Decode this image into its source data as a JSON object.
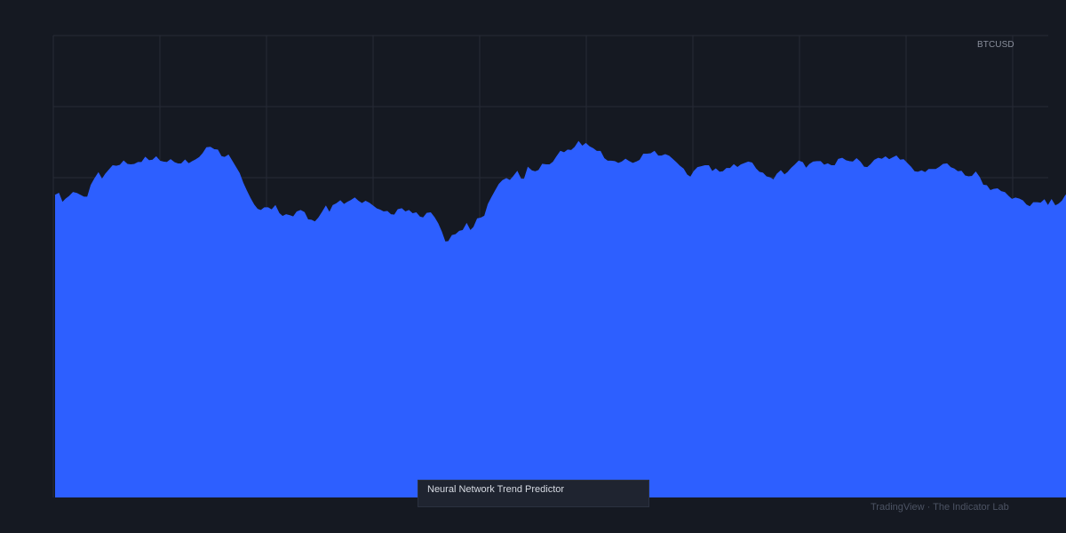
{
  "symbol": "BTCUSD",
  "indicator_label": "Neural Network Trend Predictor",
  "footer_brand": "TradingView · The Indicator Lab",
  "colors": {
    "background": "#151922",
    "grid": "#262b36",
    "area_fill": "#2d5fff"
  },
  "chart_data": {
    "type": "area",
    "title": "",
    "xlabel": "",
    "ylabel": "",
    "grid": true,
    "ylim": [
      0,
      100
    ],
    "x": [
      0,
      1,
      2,
      3,
      4,
      5,
      6,
      7,
      8,
      9,
      10,
      11,
      12,
      13,
      14,
      15,
      16,
      17,
      18,
      19,
      20,
      21,
      22,
      23,
      24,
      25,
      26,
      27,
      28,
      29,
      30,
      31,
      32,
      33,
      34,
      35,
      36,
      37,
      38,
      39,
      40,
      41,
      42,
      43,
      44,
      45,
      46,
      47,
      48,
      49,
      50,
      51,
      52,
      53,
      54,
      55,
      56,
      57,
      58,
      59,
      60,
      61,
      62,
      63,
      64,
      65,
      66,
      67,
      68,
      69,
      70,
      71,
      72,
      73,
      74,
      75,
      76,
      77,
      78,
      79,
      80,
      81,
      82,
      83,
      84,
      85,
      86,
      87,
      88,
      89,
      90,
      91,
      92,
      93,
      94,
      95,
      96,
      97,
      98,
      99,
      100,
      101,
      102,
      103,
      104,
      105,
      106,
      107,
      108,
      109,
      110,
      111,
      112,
      113,
      114,
      115,
      116,
      117,
      118,
      119,
      120,
      121,
      122,
      123,
      124,
      125,
      126,
      127,
      128,
      129,
      130,
      131,
      132,
      133,
      134,
      135,
      136,
      137,
      138,
      139,
      140,
      141,
      142,
      143,
      144,
      145,
      146,
      147,
      148,
      149,
      150,
      151,
      152,
      153,
      154,
      155,
      156,
      157,
      158,
      159,
      160,
      161,
      162,
      163,
      164,
      165,
      166,
      167,
      168,
      169,
      170,
      171,
      172,
      173,
      174,
      175,
      176,
      177,
      178,
      179,
      180,
      181,
      182,
      183,
      184,
      185,
      186,
      187,
      188,
      189,
      190,
      191,
      192,
      193,
      194,
      195,
      196,
      197,
      198,
      199,
      200,
      201,
      202,
      203,
      204,
      205,
      206,
      207,
      208,
      209,
      210,
      211,
      212,
      213,
      214,
      215,
      216,
      217,
      218,
      219,
      220,
      221,
      222,
      223,
      224,
      225,
      226,
      227,
      228,
      229,
      230,
      231,
      232,
      233,
      234,
      235,
      236,
      237,
      238,
      239,
      240,
      241,
      242,
      243,
      244,
      245,
      246,
      247,
      248,
      249,
      250,
      251,
      252,
      253,
      254,
      255,
      256,
      257,
      258,
      259,
      260,
      261,
      262,
      263,
      264,
      265,
      266,
      267,
      268,
      269,
      270,
      271,
      272,
      273,
      274,
      275,
      276,
      277,
      278,
      279,
      280,
      281,
      282,
      283,
      284
    ],
    "series": [
      {
        "values": [
          65.4,
          65.8,
          63.8,
          64.6,
          65.2,
          66.0,
          65.8,
          65.4,
          65.0,
          65.0,
          67.6,
          69.0,
          70.2,
          68.8,
          70.0,
          70.9,
          71.8,
          71.7,
          71.9,
          72.8,
          72.1,
          72.0,
          72.1,
          72.5,
          72.5,
          73.6,
          72.9,
          73.0,
          73.7,
          72.8,
          72.6,
          72.5,
          73.1,
          72.5,
          72.2,
          72.2,
          73.0,
          72.2,
          72.7,
          73.1,
          73.6,
          74.5,
          75.7,
          75.8,
          75.3,
          75.2,
          73.8,
          73.6,
          74.1,
          72.8,
          71.5,
          70.2,
          68.1,
          66.4,
          64.8,
          63.4,
          62.4,
          62.1,
          62.7,
          62.7,
          62.2,
          63.1,
          61.5,
          60.8,
          61.2,
          61.0,
          60.7,
          61.8,
          62.1,
          61.7,
          60.1,
          60.0,
          59.6,
          60.5,
          61.7,
          63.0,
          61.6,
          63.2,
          63.6,
          64.2,
          63.4,
          63.9,
          64.3,
          64.8,
          64.1,
          63.6,
          64.1,
          63.7,
          63.1,
          62.5,
          62.2,
          61.8,
          61.9,
          61.2,
          61.1,
          62.3,
          62.5,
          61.8,
          62.1,
          61.4,
          61.6,
          60.7,
          60.5,
          61.5,
          61.6,
          60.6,
          59.3,
          57.5,
          55.3,
          55.4,
          56.7,
          56.9,
          57.6,
          57.8,
          59.2,
          57.7,
          58.5,
          60.3,
          60.5,
          60.9,
          63.5,
          65.0,
          66.4,
          67.8,
          68.6,
          69.0,
          68.6,
          69.5,
          70.5,
          68.9,
          68.9,
          71.4,
          70.7,
          70.5,
          70.8,
          72.1,
          72.0,
          72.0,
          72.6,
          73.8,
          74.9,
          74.6,
          75.2,
          75.1,
          75.8,
          77.0,
          76.0,
          76.6,
          75.9,
          75.5,
          74.9,
          74.9,
          73.4,
          72.8,
          72.8,
          72.7,
          72.3,
          72.6,
          73.2,
          72.7,
          72.3,
          72.6,
          73.0,
          74.3,
          74.3,
          74.4,
          74.9,
          73.9,
          73.9,
          74.2,
          73.9,
          73.2,
          72.5,
          71.7,
          71.1,
          69.8,
          69.3,
          70.6,
          71.4,
          71.6,
          71.8,
          71.8,
          70.5,
          71.1,
          70.4,
          70.5,
          71.2,
          71.2,
          72.0,
          71.4,
          72.0,
          72.3,
          72.6,
          72.4,
          71.2,
          70.4,
          70.2,
          69.4,
          69.2,
          68.7,
          70.0,
          70.7,
          69.8,
          70.4,
          71.3,
          72.0,
          72.8,
          72.5,
          71.2,
          72.1,
          72.6,
          72.7,
          72.7,
          71.9,
          72.2,
          71.8,
          71.8,
          73.2,
          73.4,
          72.9,
          72.7,
          72.6,
          73.3,
          72.6,
          71.5,
          71.4,
          72.1,
          73.0,
          73.4,
          73.2,
          73.7,
          73.1,
          73.5,
          73.9,
          73.0,
          73.1,
          72.3,
          71.5,
          70.5,
          70.4,
          70.7,
          70.3,
          71.0,
          71.0,
          71.0,
          71.5,
          72.1,
          72.2,
          71.4,
          71.1,
          70.5,
          70.6,
          69.6,
          69.4,
          69.5,
          70.4,
          69.3,
          67.6,
          67.5,
          66.4,
          66.7,
          66.8,
          66.2,
          66.0,
          65.2,
          64.5,
          64.8,
          64.6,
          64.2,
          63.3,
          62.9,
          63.8,
          63.8,
          63.7,
          64.4,
          63.1,
          64.4,
          63.1,
          63.5,
          64.2,
          65.5
        ]
      }
    ]
  }
}
